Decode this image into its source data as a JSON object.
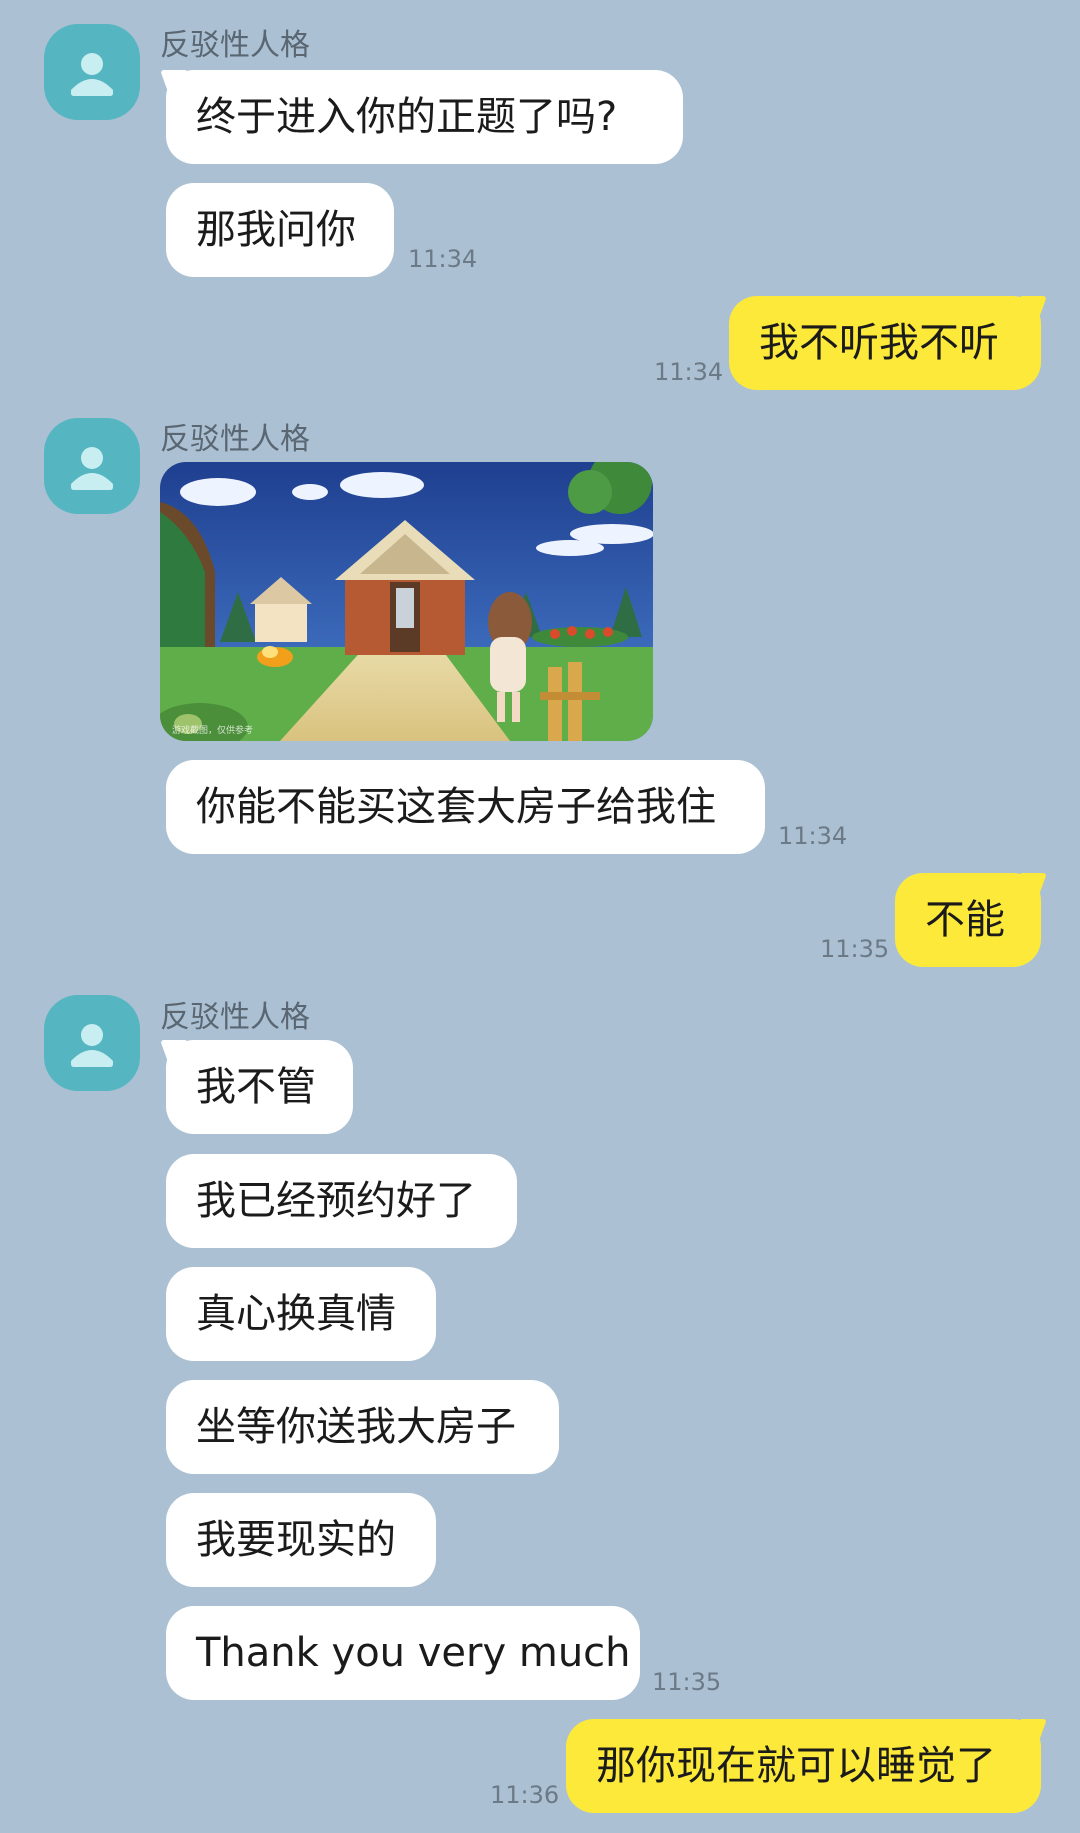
{
  "chat": {
    "contact_name": "反驳性人格",
    "messages": [
      {
        "text": "终于进入你的正题了吗?"
      },
      {
        "text": "那我问你",
        "time": "11:34"
      },
      {
        "text": "我不听我不听",
        "time": "11:34"
      },
      {
        "text": "你能不能买这套大房子给我住",
        "time": "11:34"
      },
      {
        "text": "不能",
        "time": "11:35"
      },
      {
        "text": "我不管"
      },
      {
        "text": "我已经预约好了"
      },
      {
        "text": "真心换真情"
      },
      {
        "text": "坐等你送我大房子"
      },
      {
        "text": "我要现实的"
      },
      {
        "text": "Thank you very much",
        "time": "11:35"
      },
      {
        "text": "那你现在就可以睡觉了",
        "time": "11:36"
      }
    ],
    "image": {
      "caption": "游戏截图，仅供参考"
    }
  },
  "colors": {
    "background": "#abc1d3",
    "incoming_bubble": "#ffffff",
    "outgoing_bubble": "#fde93a",
    "avatar": "#55b6c1"
  }
}
